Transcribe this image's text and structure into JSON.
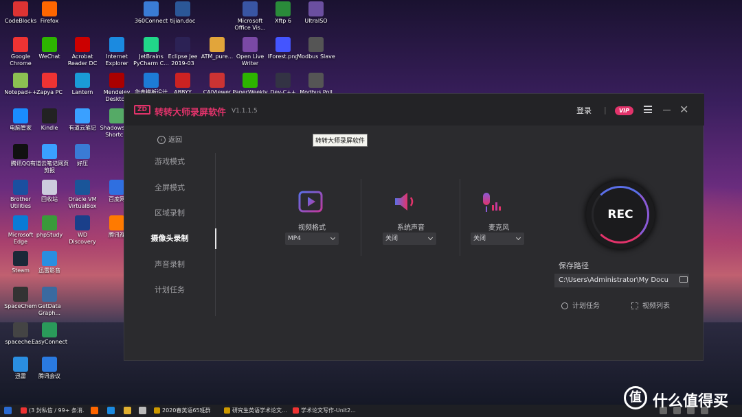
{
  "desktop_icons": [
    {
      "label": "CodeBlocks",
      "color": "#d33"
    },
    {
      "label": "Firefox",
      "color": "#f60"
    },
    {
      "label": "360Connect",
      "color": "#3a7bd5"
    },
    {
      "label": "tijian.doc",
      "color": "#2b5797"
    },
    {
      "label": "Microsoft Office Vis...",
      "color": "#3955a3"
    },
    {
      "label": "Xftp 6",
      "color": "#2a8c3a"
    },
    {
      "label": "UltraISO",
      "color": "#6b4fa0"
    },
    {
      "label": "Google Chrome",
      "color": "#e33"
    },
    {
      "label": "WeChat",
      "color": "#2db400"
    },
    {
      "label": "Acrobat Reader DC",
      "color": "#c00"
    },
    {
      "label": "Internet Explorer",
      "color": "#1b8ae0"
    },
    {
      "label": "JetBrains PyCharm C...",
      "color": "#21d789"
    },
    {
      "label": "Eclipse Jee 2019-03",
      "color": "#2c2255"
    },
    {
      "label": "ATM_pure...",
      "color": "#e2a53a"
    },
    {
      "label": "Open Live Writer",
      "color": "#7a49a5"
    },
    {
      "label": "IForest.png",
      "color": "#4455ff"
    },
    {
      "label": "Modbus Slave",
      "color": "#555"
    },
    {
      "label": "Notepad++",
      "color": "#8cc152"
    },
    {
      "label": "Zapya PC",
      "color": "#e33"
    },
    {
      "label": "Lantern",
      "color": "#1a9bd7"
    },
    {
      "label": "Mendeley Desktop",
      "color": "#a00"
    },
    {
      "label": "华表模板设计",
      "color": "#1d7bd6"
    },
    {
      "label": "ABBYY",
      "color": "#c22"
    },
    {
      "label": "CAJViewer",
      "color": "#c33"
    },
    {
      "label": "PaperWeekly",
      "color": "#2db400"
    },
    {
      "label": "Dev-C++",
      "color": "#334"
    },
    {
      "label": "Modbus Poll",
      "color": "#555"
    },
    {
      "label": "电脑管家",
      "color": "#1a8cff"
    },
    {
      "label": "Kindle",
      "color": "#222"
    },
    {
      "label": "有道云笔记",
      "color": "#3aa0ff"
    },
    {
      "label": "Shadows... - Shortc...",
      "color": "#5a6"
    },
    {
      "label": "腾讯QQ",
      "color": "#111"
    },
    {
      "label": "有道云笔记网页剪报",
      "color": "#3aa0ff"
    },
    {
      "label": "好压",
      "color": "#3a7bd5"
    },
    {
      "label": "Brother Utilities",
      "color": "#1a4fa0"
    },
    {
      "label": "回收站",
      "color": "#ccd"
    },
    {
      "label": "Oracle VM VirtualBox",
      "color": "#1a5599"
    },
    {
      "label": "百度网",
      "color": "#2f6fe0"
    },
    {
      "label": "Microsoft Edge",
      "color": "#0a7bd6"
    },
    {
      "label": "phpStudy",
      "color": "#3a9a3a"
    },
    {
      "label": "WD Discovery",
      "color": "#1a3f8a"
    },
    {
      "label": "腾讯视",
      "color": "#ff7a00"
    },
    {
      "label": "Steam",
      "color": "#1b2838"
    },
    {
      "label": "迅雷影音",
      "color": "#2a8ee0"
    },
    {
      "label": "SpaceChem",
      "color": "#333"
    },
    {
      "label": "GetData Graph...",
      "color": "#3a6aa0"
    },
    {
      "label": "spaceche...",
      "color": "#444"
    },
    {
      "label": "EasyConnect",
      "color": "#2a9a5a"
    },
    {
      "label": "迅雷",
      "color": "#2a8ee0"
    },
    {
      "label": "腾讯会议",
      "color": "#2a7ae0"
    }
  ],
  "app": {
    "title": "转转大师录屏软件",
    "version": "V1.1.1.5",
    "logo": "ZD",
    "login": "登录",
    "separator": "|",
    "vip": "VIP",
    "tooltip": "转转大师录屏软件",
    "back": "返回",
    "back_icon": "‹"
  },
  "sidebar": {
    "items": [
      {
        "label": "游戏模式",
        "active": false
      },
      {
        "label": "全屏模式",
        "active": false
      },
      {
        "label": "区域录制",
        "active": false
      },
      {
        "label": "摄像头录制",
        "active": true
      },
      {
        "label": "声音录制",
        "active": false
      },
      {
        "label": "计划任务",
        "active": false
      }
    ]
  },
  "options": {
    "video_format": {
      "label": "视频格式",
      "value": "MP4"
    },
    "system_sound": {
      "label": "系统声音",
      "value": "关闭"
    },
    "microphone": {
      "label": "麦克风",
      "value": "关闭"
    }
  },
  "record": {
    "rec_label": "REC",
    "save_path_label": "保存路径",
    "save_path": "C:\\Users\\Administrator\\My Docu",
    "schedule": "计划任务",
    "video_list": "视频列表"
  },
  "taskbar": {
    "items": [
      {
        "label": "(3 封私信 / 99+ 条消...",
        "color": "#e33"
      },
      {
        "label": "2020春英语65班群",
        "color": "#c90"
      },
      {
        "label": "研究生英语学术论文...",
        "color": "#c90"
      },
      {
        "label": "学术论文写作-Unit2....",
        "color": "#e33"
      }
    ]
  },
  "watermark": {
    "icon": "值",
    "text": "什么值得买"
  },
  "colors": {
    "accent": "#e2336b",
    "window_bg": "#2b2b2e",
    "titlebar_bg": "#232326"
  }
}
